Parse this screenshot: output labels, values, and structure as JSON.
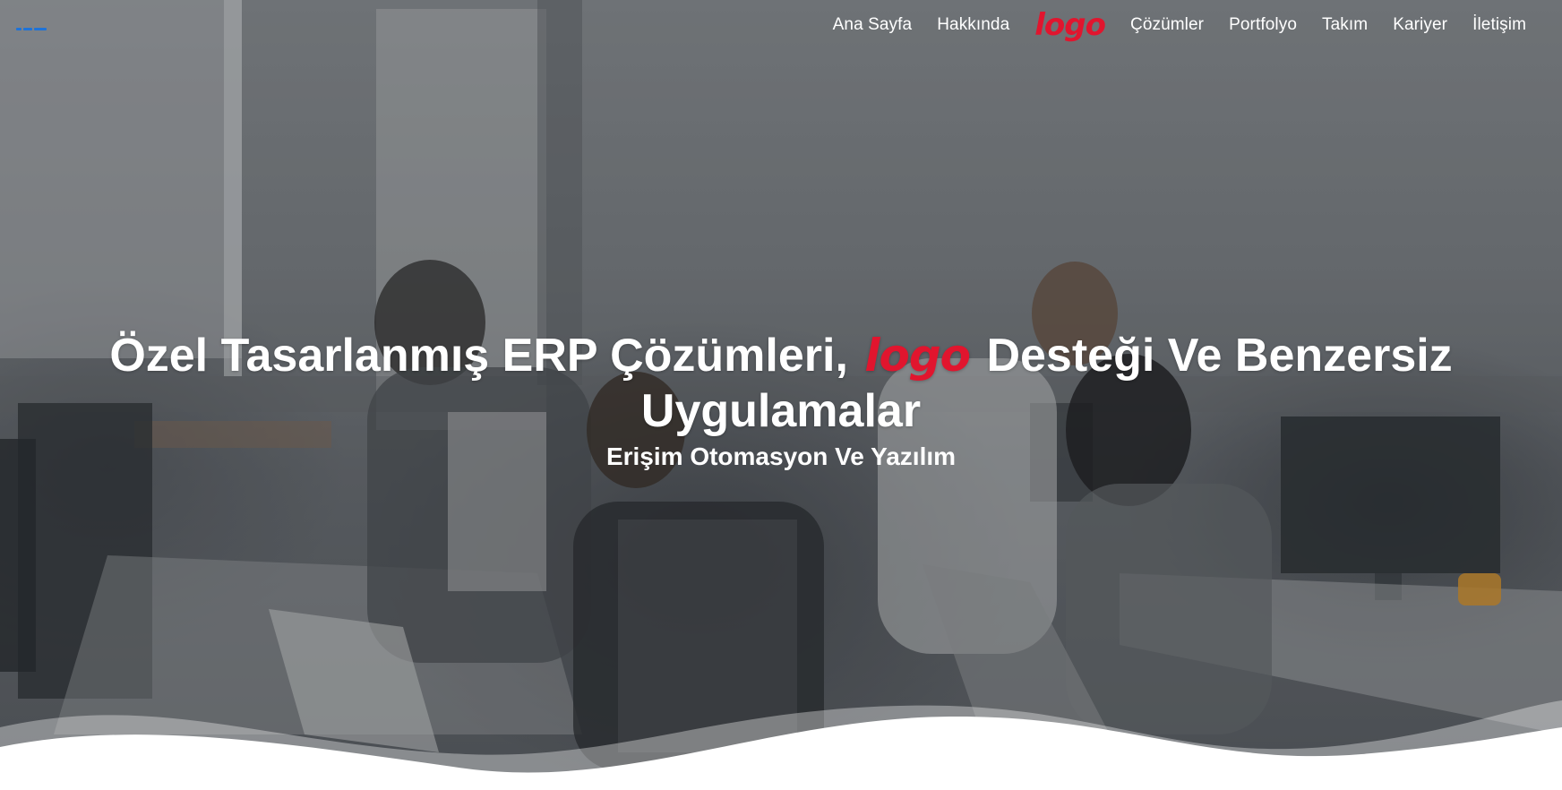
{
  "header": {
    "nav_items": [
      {
        "label": "Ana Sayfa"
      },
      {
        "label": "Hakkında"
      },
      {
        "label": "Çözümler"
      },
      {
        "label": "Portfolyo"
      },
      {
        "label": "Takım"
      },
      {
        "label": "Kariyer"
      },
      {
        "label": "İletişim"
      }
    ],
    "center_logo": "logo"
  },
  "hero": {
    "title_part1": "Özel Tasarlanmış ERP Çözümleri,",
    "title_logo": "logo",
    "title_part2": "Desteği Ve Benzersiz",
    "title_part3": "Uygulamalar",
    "subtitle": "Erişim Otomasyon Ve Yazılım"
  },
  "colors": {
    "logo_red": "#e1152e",
    "text": "#ffffff",
    "brand_blue": "#1e73d8"
  },
  "icons": {
    "brand_mark": "erisim-brand-mark",
    "logo": "logo-wordmark"
  }
}
